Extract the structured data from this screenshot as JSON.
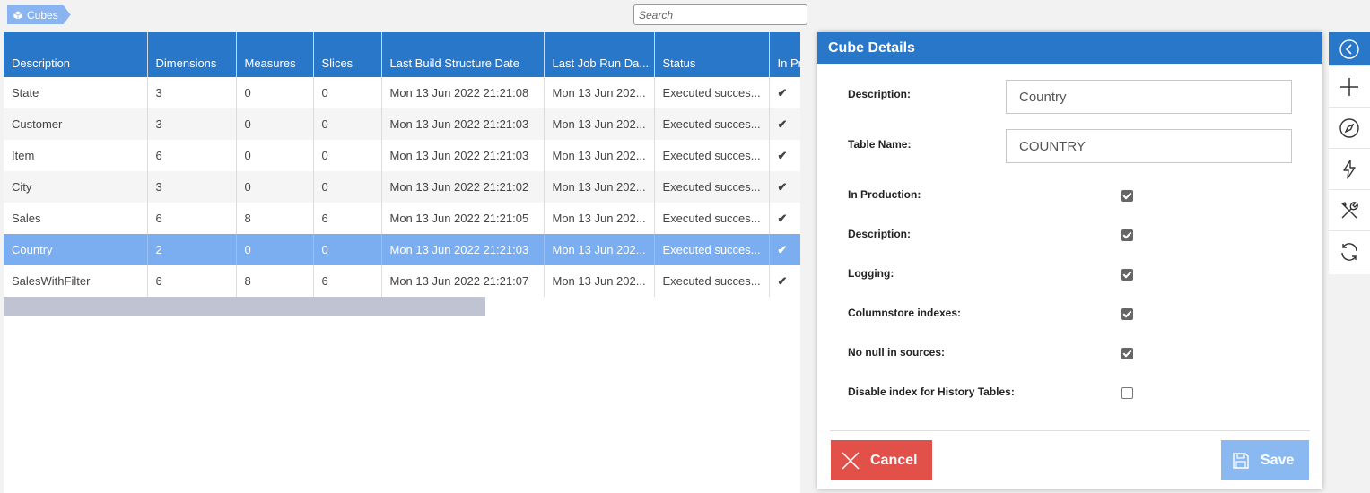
{
  "breadcrumb": {
    "label": "Cubes"
  },
  "search": {
    "placeholder": "Search",
    "value": ""
  },
  "grid": {
    "columns": [
      "Description",
      "Dimensions",
      "Measures",
      "Slices",
      "Last Build Structure Date",
      "Last Job Run Da...",
      "Status",
      "In Pr"
    ],
    "rows": [
      {
        "description": "State",
        "dimensions": "3",
        "measures": "0",
        "slices": "0",
        "last_build": "Mon 13 Jun 2022 21:21:08",
        "last_job": "Mon 13 Jun 202...",
        "status": "Executed succes...",
        "in_production": "✔"
      },
      {
        "description": "Customer",
        "dimensions": "3",
        "measures": "0",
        "slices": "0",
        "last_build": "Mon 13 Jun 2022 21:21:03",
        "last_job": "Mon 13 Jun 202...",
        "status": "Executed succes...",
        "in_production": "✔"
      },
      {
        "description": "Item",
        "dimensions": "6",
        "measures": "0",
        "slices": "0",
        "last_build": "Mon 13 Jun 2022 21:21:03",
        "last_job": "Mon 13 Jun 202...",
        "status": "Executed succes...",
        "in_production": "✔"
      },
      {
        "description": "City",
        "dimensions": "3",
        "measures": "0",
        "slices": "0",
        "last_build": "Mon 13 Jun 2022 21:21:02",
        "last_job": "Mon 13 Jun 202...",
        "status": "Executed succes...",
        "in_production": "✔"
      },
      {
        "description": "Sales",
        "dimensions": "6",
        "measures": "8",
        "slices": "6",
        "last_build": "Mon 13 Jun 2022 21:21:05",
        "last_job": "Mon 13 Jun 202...",
        "status": "Executed succes...",
        "in_production": "✔"
      },
      {
        "description": "Country",
        "dimensions": "2",
        "measures": "0",
        "slices": "0",
        "last_build": "Mon 13 Jun 2022 21:21:03",
        "last_job": "Mon 13 Jun 202...",
        "status": "Executed succes...",
        "in_production": "✔"
      },
      {
        "description": "SalesWithFilter",
        "dimensions": "6",
        "measures": "8",
        "slices": "6",
        "last_build": "Mon 13 Jun 2022 21:21:07",
        "last_job": "Mon 13 Jun 202...",
        "status": "Executed succes...",
        "in_production": "✔"
      }
    ],
    "selected_row": "Country"
  },
  "details": {
    "title": "Cube Details",
    "description_label": "Description:",
    "description_value": "Country",
    "table_name_label": "Table Name:",
    "table_name_value": "COUNTRY",
    "checkboxes": [
      {
        "label": "In Production:",
        "checked": true
      },
      {
        "label": "Description:",
        "checked": true
      },
      {
        "label": "Logging:",
        "checked": true
      },
      {
        "label": "Columnstore indexes:",
        "checked": true
      },
      {
        "label": "No null in sources:",
        "checked": true
      },
      {
        "label": "Disable index for History Tables:",
        "checked": false
      }
    ],
    "cancel_label": "Cancel",
    "save_label": "Save"
  },
  "toolbar": {
    "icons": [
      "back-circle-icon",
      "plus-icon",
      "compass-icon",
      "lightning-icon",
      "tools-icon",
      "refresh-icon"
    ]
  },
  "colors": {
    "header": "#2877c9",
    "selected_row": "#7baef0",
    "cancel": "#e2504a",
    "save": "#8ab9f2"
  }
}
